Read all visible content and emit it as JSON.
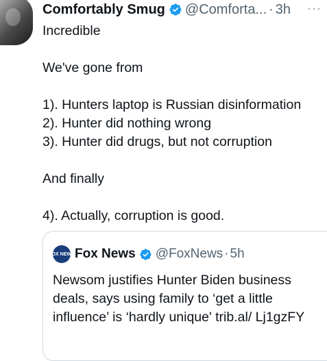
{
  "tweet": {
    "author_name": "Comfortably Smug",
    "handle": "@Comforta...",
    "separator": "·",
    "time": "3h",
    "more": "···",
    "lines": [
      "Incredible",
      "",
      "We've gone from",
      "",
      "1). Hunters laptop is Russian disinformation",
      "2). Hunter did nothing wrong",
      "3). Hunter did drugs, but not corruption",
      "",
      "And finally",
      "",
      "4). Actually, corruption is good."
    ]
  },
  "quote": {
    "logo_text": "FOX NEWS",
    "author_name": "Fox News",
    "handle": "@FoxNews",
    "separator": "·",
    "time": "5h",
    "text": "Newsom justifies Hunter Biden business deals, says using family to ‘get a little influence’ is ‘hardly unique' trib.al/ Lj1gzFY"
  },
  "colors": {
    "verified": "#1d9bf0",
    "secondary_text": "#536471",
    "border": "#cfd9de"
  }
}
